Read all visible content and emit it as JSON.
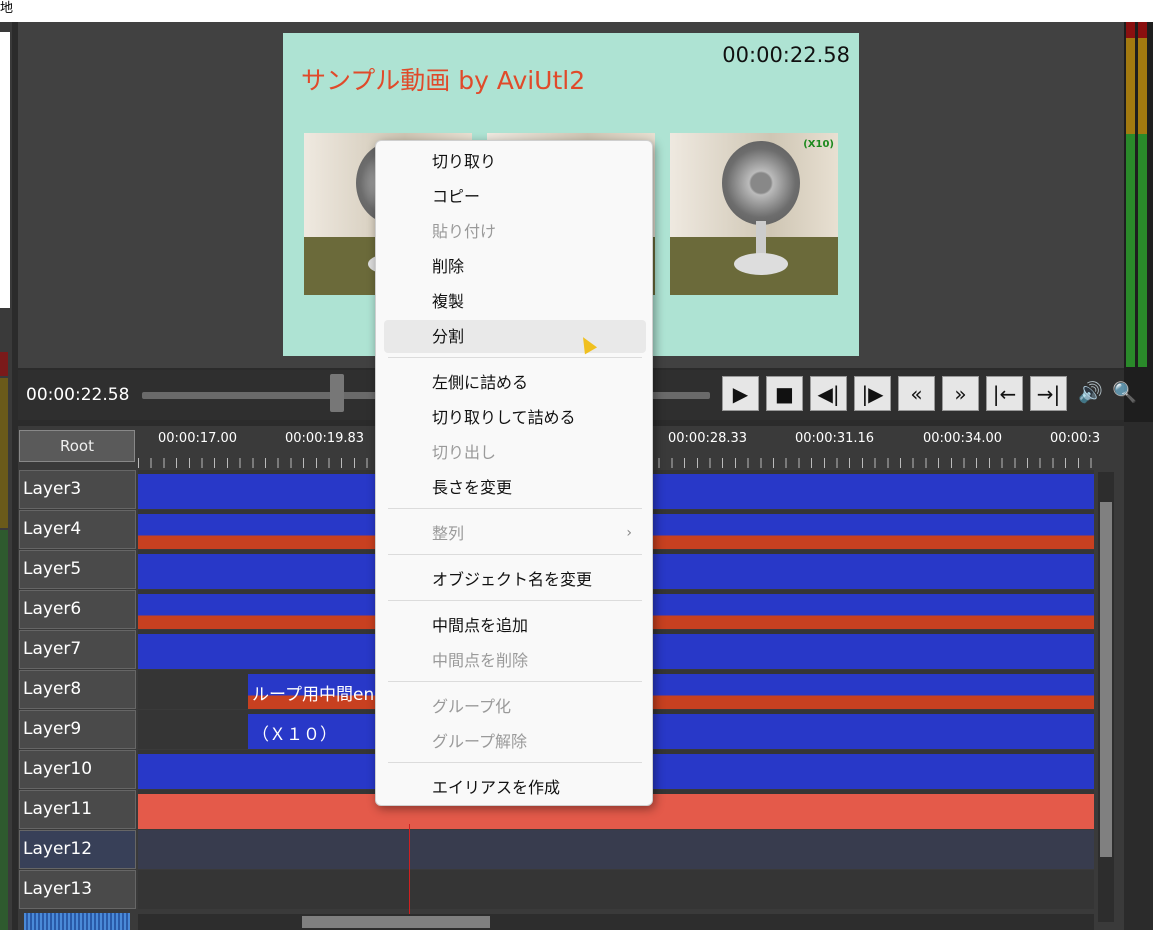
{
  "window": {
    "title": "地"
  },
  "preview": {
    "title": "サンプル動画 by AviUtl2",
    "timecode": "00:00:22.58",
    "thumb_label": "(X10)"
  },
  "transport": {
    "current_time": "00:00:22.58",
    "buttons": [
      "play-icon",
      "stop-icon",
      "prev-frame-icon",
      "next-frame-icon",
      "rewind-icon",
      "fast-forward-icon",
      "jump-start-icon",
      "jump-end-icon",
      "volume-icon",
      "zoom-icon"
    ]
  },
  "timeline": {
    "root_label": "Root",
    "ruler_labels": [
      "00:00:17.00",
      "00:00:19.83",
      "00:00:28.33",
      "00:00:31.16",
      "00:00:34.00",
      "00:00:3"
    ],
    "layers": [
      "Layer3",
      "Layer4",
      "Layer5",
      "Layer6",
      "Layer7",
      "Layer8",
      "Layer9",
      "Layer10",
      "Layer11",
      "Layer12",
      "Layer13"
    ],
    "clip_texts": {
      "layer8": "ループ用中間en",
      "layer9": "（Ｘ１０）"
    }
  },
  "context_menu": {
    "items": [
      {
        "label": "切り取り",
        "enabled": true
      },
      {
        "label": "コピー",
        "enabled": true
      },
      {
        "label": "貼り付け",
        "enabled": false
      },
      {
        "label": "削除",
        "enabled": true
      },
      {
        "label": "複製",
        "enabled": true
      },
      {
        "label": "分割",
        "enabled": true,
        "hovered": true
      },
      {
        "label": "左側に詰める",
        "enabled": true
      },
      {
        "label": "切り取りして詰める",
        "enabled": true
      },
      {
        "label": "切り出し",
        "enabled": false
      },
      {
        "label": "長さを変更",
        "enabled": true
      },
      {
        "label": "整列",
        "enabled": false,
        "submenu": true
      },
      {
        "label": "オブジェクト名を変更",
        "enabled": true
      },
      {
        "label": "中間点を追加",
        "enabled": true
      },
      {
        "label": "中間点を削除",
        "enabled": false
      },
      {
        "label": "グループ化",
        "enabled": false
      },
      {
        "label": "グループ解除",
        "enabled": false
      },
      {
        "label": "エイリアスを作成",
        "enabled": true
      }
    ]
  },
  "colors": {
    "clip_blue": "#2838c8",
    "clip_audio_red": "#c84020",
    "audio_clip": "#e45a4a",
    "preview_bg": "#aee3d3",
    "preview_title": "#e04a2a"
  }
}
